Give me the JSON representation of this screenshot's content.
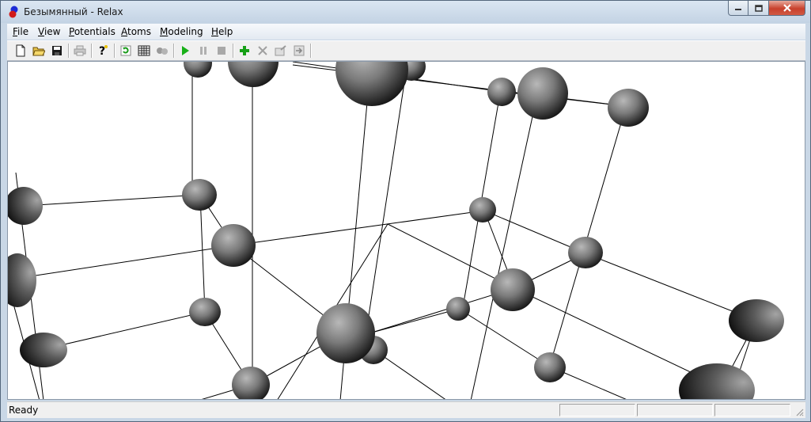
{
  "window": {
    "title": "Безымянный - Relax"
  },
  "menubar": {
    "items": [
      {
        "label": "File",
        "u": "F"
      },
      {
        "label": "View",
        "u": "V"
      },
      {
        "label": "Potentials",
        "u": "P"
      },
      {
        "label": "Atoms",
        "u": "A"
      },
      {
        "label": "Modeling",
        "u": "M"
      },
      {
        "label": "Help",
        "u": "H"
      }
    ]
  },
  "toolbar": {
    "buttons": [
      {
        "name": "new-file-icon",
        "enabled": true
      },
      {
        "name": "open-folder-icon",
        "enabled": true
      },
      {
        "name": "save-icon",
        "enabled": true
      },
      {
        "name": "print-icon",
        "enabled": false
      },
      {
        "name": "help-question-icon",
        "enabled": true
      },
      {
        "name": "refresh-icon",
        "enabled": true
      },
      {
        "name": "table-icon",
        "enabled": true
      },
      {
        "name": "atoms-icon",
        "enabled": false
      },
      {
        "name": "play-icon",
        "enabled": true
      },
      {
        "name": "pause-icon",
        "enabled": false
      },
      {
        "name": "stop-icon",
        "enabled": false
      },
      {
        "name": "add-plus-icon",
        "enabled": true
      },
      {
        "name": "delete-x-icon",
        "enabled": false
      },
      {
        "name": "properties-icon",
        "enabled": false
      },
      {
        "name": "export-icon",
        "enabled": false
      }
    ]
  },
  "status": {
    "text": "Ready",
    "panels": [
      "",
      "",
      ""
    ]
  },
  "colors": {
    "accent": "#c8402c",
    "viewport_bg": "#ffffff",
    "atom_shade": "#7a7a7a"
  }
}
